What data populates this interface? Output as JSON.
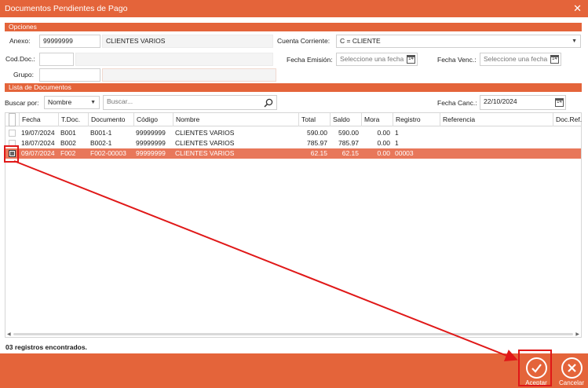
{
  "window": {
    "title": "Documentos Pendientes de Pago",
    "close_glyph": "✕"
  },
  "opciones": {
    "header": "Opciones",
    "anexo_label": "Anexo:",
    "anexo_code": "99999999",
    "anexo_name": "CLIENTES VARIOS",
    "cuenta_label": "Cuenta Corriente:",
    "cuenta_value": "C = CLIENTE",
    "coddoc_label": "Cod.Doc.:",
    "coddoc_value": "",
    "fecha_emision_label": "Fecha Emisión:",
    "fecha_emision_placeholder": "Seleccione una fecha",
    "fecha_venc_label": "Fecha Venc.:",
    "fecha_venc_placeholder": "Seleccione una fecha",
    "grupo_label": "Grupo:",
    "grupo_value": ""
  },
  "lista": {
    "header": "Lista de Documentos",
    "buscar_por_label": "Buscar por:",
    "buscar_por_value": "Nombre",
    "search_placeholder": "Buscar...",
    "fecha_canc_label": "Fecha Canc.:",
    "fecha_canc_value": "22/10/2024",
    "calendar_day": "14"
  },
  "table": {
    "columns": [
      "Fecha",
      "T.Doc.",
      "Documento",
      "Código",
      "Nombre",
      "Total",
      "Saldo",
      "Mora",
      "Registro",
      "Referencia",
      "Doc.Ref."
    ],
    "rows": [
      {
        "fecha": "19/07/2024",
        "tdoc": "B001",
        "documento": "B001-1",
        "codigo": "99999999",
        "nombre": "CLIENTES VARIOS",
        "total": "590.00",
        "saldo": "590.00",
        "mora": "0.00",
        "registro": "1",
        "referencia": "",
        "docref": "",
        "selected": false
      },
      {
        "fecha": "18/07/2024",
        "tdoc": "B002",
        "documento": "B002-1",
        "codigo": "99999999",
        "nombre": "CLIENTES VARIOS",
        "total": "785.97",
        "saldo": "785.97",
        "mora": "0.00",
        "registro": "1",
        "referencia": "",
        "docref": "",
        "selected": false
      },
      {
        "fecha": "09/07/2024",
        "tdoc": "F002",
        "documento": "F002-00003",
        "codigo": "99999999",
        "nombre": "CLIENTES VARIOS",
        "total": "62.15",
        "saldo": "62.15",
        "mora": "0.00",
        "registro": "00003",
        "referencia": "",
        "docref": "",
        "selected": true
      }
    ]
  },
  "status_text": "03 registros encontrados.",
  "footer": {
    "aceptar_label": "Aceptar",
    "cancelar_label": "Cancelar"
  },
  "colors": {
    "accent": "#e4643a",
    "selected_row": "#e8775a",
    "annotation": "#e01818"
  },
  "icons": [
    "close-icon",
    "search-icon",
    "calendar-icon",
    "chevron-down-icon",
    "check-icon",
    "x-icon"
  ]
}
